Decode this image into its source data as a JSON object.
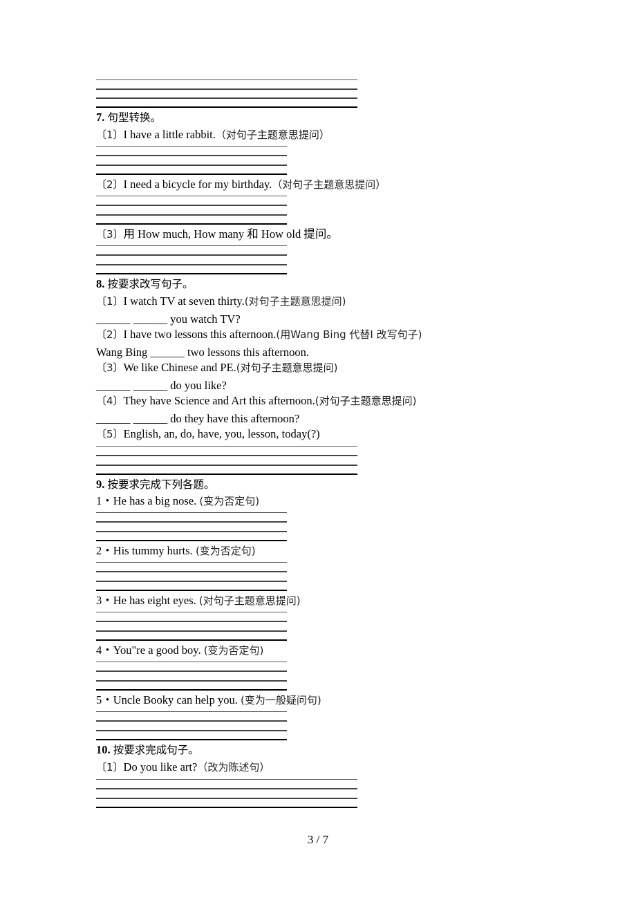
{
  "page": {
    "current": 3,
    "total": 7,
    "label": "3 / 7"
  },
  "sections": [
    {
      "id": "q7",
      "title_num": "7.",
      "title_cn": "句型转换。",
      "items": [
        {
          "label": "〔1〕",
          "en": "I have a little rabbit.",
          "cn": "（对句子主题意思提问）"
        },
        {
          "label": "〔2〕",
          "en": "I need a bicycle for my birthday.",
          "cn": "（对句子主题意思提问）"
        },
        {
          "label": "〔3〕",
          "en": "用 How much, How many 和 How old 提问。",
          "cn": ""
        }
      ]
    },
    {
      "id": "q8",
      "title_num": "8.",
      "title_cn": "按要求改写句子。",
      "items": [
        {
          "label": "〔1〕",
          "en": "I watch TV at seven thirty.",
          "cn": "(对句子主题意思提问)",
          "answer": "______ ______ you watch TV?"
        },
        {
          "label": "〔2〕",
          "en": "I have two lessons this afternoon.",
          "cn": "(用Wang Bing 代替I 改写句子)",
          "answer": "Wang Bing ______ two lessons this afternoon."
        },
        {
          "label": "〔3〕",
          "en": "We like Chinese and PE.",
          "cn": "(对句子主题意思提问)",
          "answer": "______ ______ do you like?"
        },
        {
          "label": "〔4〕",
          "en": "They have Science and Art this afternoon.",
          "cn": "(对句子主题意思提问)",
          "answer": "______ ______ do they have this afternoon?"
        },
        {
          "label": "〔5〕",
          "en": "English, an, do, have, you, lesson, today(?)",
          "cn": ""
        }
      ]
    },
    {
      "id": "q9",
      "title_num": "9.",
      "title_cn": "按要求完成下列各题。",
      "items": [
        {
          "label": "1・",
          "en": "He has a big nose. ",
          "cn": "(变为否定句)"
        },
        {
          "label": "2・",
          "en": "His tummy hurts. ",
          "cn": "(变为否定句)"
        },
        {
          "label": "3・",
          "en": "He has eight eyes. ",
          "cn": "(对句子主题意思提问)"
        },
        {
          "label": "4・",
          "en": "You\"re a good boy. ",
          "cn": "(变为否定句)"
        },
        {
          "label": "5・",
          "en": "Uncle Booky can help you. ",
          "cn": "(变为一般疑问句)"
        }
      ]
    },
    {
      "id": "q10",
      "title_num": "10.",
      "title_cn": "按要求完成句子。",
      "items": [
        {
          "label": "〔1〕",
          "en": "Do you like art?",
          "cn": "（改为陈述句）"
        }
      ]
    }
  ]
}
